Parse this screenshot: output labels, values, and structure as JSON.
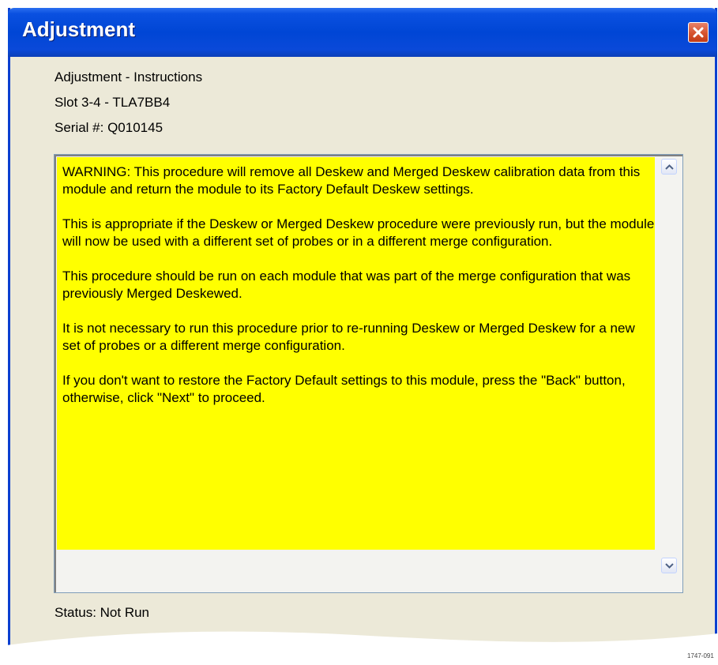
{
  "window": {
    "title": "Adjustment",
    "close_icon": "close-icon"
  },
  "info": {
    "heading": "Adjustment -  Instructions",
    "slot": "Slot 3-4 - TLA7BB4",
    "serial": "Serial #: Q010145"
  },
  "instructions": {
    "paragraphs": [
      "WARNING: This procedure will remove all Deskew and Merged Deskew calibration data from this module and return the module to its Factory Default Deskew settings.",
      "This is appropriate if the Deskew or Merged Deskew procedure were previously run, but the module will now be used with a different set of probes or in a different merge configuration.",
      "This procedure should be run on each module that was part of the merge configuration that was previously Merged Deskewed.",
      "It is not necessary to run this procedure prior to re-running Deskew or Merged Deskew for a new set of probes or a different merge configuration.",
      "If you don't want to restore the Factory Default settings to this module, press the \"Back\" button, otherwise, click \"Next\" to proceed."
    ],
    "highlight_color": "#ffff00"
  },
  "status": {
    "text": "Status:  Not Run"
  },
  "figure_id": "1747-091"
}
